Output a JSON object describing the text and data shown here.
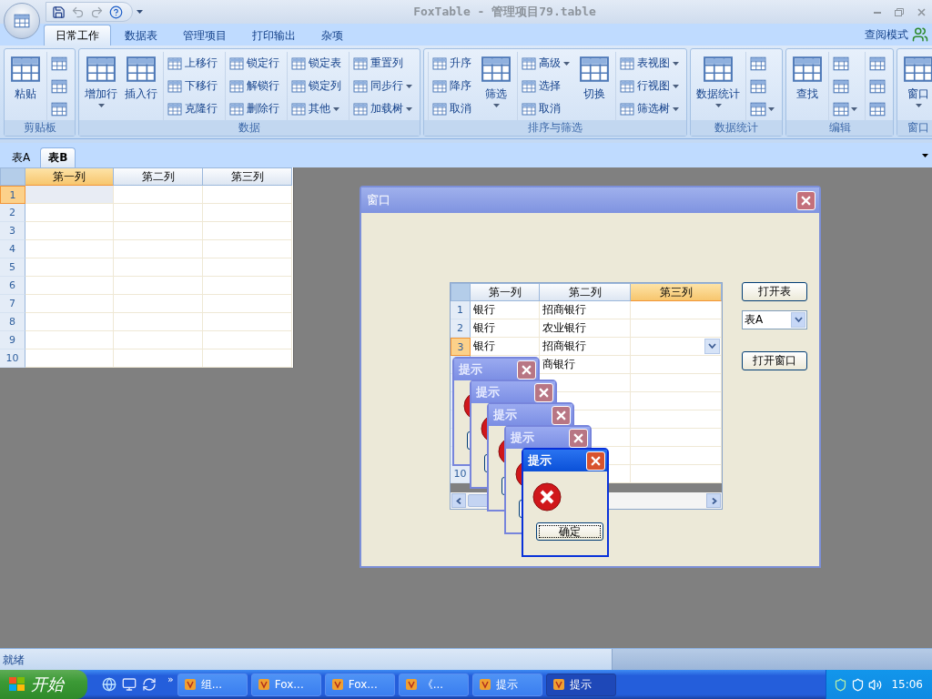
{
  "window": {
    "title": "FoxTable - 管理项目79.table"
  },
  "ribbon": {
    "tabs": [
      {
        "label": "日常工作",
        "selected": true
      },
      {
        "label": "数据表",
        "selected": false
      },
      {
        "label": "管理项目",
        "selected": false
      },
      {
        "label": "打印输出",
        "selected": false
      },
      {
        "label": "杂项",
        "selected": false
      }
    ],
    "mode_label": "查阅模式",
    "groups": [
      {
        "label": "剪贴板",
        "items": [
          {
            "kind": "large",
            "label": "粘贴",
            "dropdown": false
          },
          {
            "kind": "icons",
            "buttons": [
              {
                "dropdown": false
              },
              {
                "dropdown": false
              },
              {
                "dropdown": false
              }
            ]
          }
        ]
      },
      {
        "label": "数据",
        "items": [
          {
            "kind": "large",
            "label": "增加行",
            "dropdown": true
          },
          {
            "kind": "large",
            "label": "插入行",
            "dropdown": false
          },
          {
            "kind": "column",
            "buttons": [
              {
                "label": "上移行",
                "dropdown": false
              },
              {
                "label": "下移行",
                "dropdown": false
              },
              {
                "label": "克隆行",
                "dropdown": false
              }
            ]
          },
          {
            "kind": "column",
            "buttons": [
              {
                "label": "锁定行",
                "dropdown": false
              },
              {
                "label": "解锁行",
                "dropdown": false
              },
              {
                "label": "删除行",
                "dropdown": false
              }
            ]
          },
          {
            "kind": "column",
            "buttons": [
              {
                "label": "锁定表",
                "dropdown": false
              },
              {
                "label": "锁定列",
                "dropdown": false
              },
              {
                "label": "其他",
                "dropdown": true
              }
            ]
          },
          {
            "kind": "column",
            "buttons": [
              {
                "label": "重置列",
                "dropdown": false
              },
              {
                "label": "同步行",
                "dropdown": true
              },
              {
                "label": "加载树",
                "dropdown": true
              }
            ]
          }
        ]
      },
      {
        "label": "排序与筛选",
        "items": [
          {
            "kind": "column",
            "buttons": [
              {
                "label": "升序",
                "dropdown": false
              },
              {
                "label": "降序",
                "dropdown": false
              },
              {
                "label": "取消",
                "dropdown": false
              }
            ]
          },
          {
            "kind": "large",
            "label": "筛选",
            "dropdown": true
          },
          {
            "kind": "column",
            "buttons": [
              {
                "label": "高级",
                "dropdown": true
              },
              {
                "label": "选择",
                "dropdown": false
              },
              {
                "label": "取消",
                "dropdown": false
              }
            ]
          },
          {
            "kind": "large",
            "label": "切换",
            "dropdown": false
          },
          {
            "kind": "column",
            "buttons": [
              {
                "label": "表视图",
                "dropdown": true
              },
              {
                "label": "行视图",
                "dropdown": true
              },
              {
                "label": "筛选树",
                "dropdown": true
              }
            ]
          }
        ]
      },
      {
        "label": "数据统计",
        "items": [
          {
            "kind": "large",
            "label": "数据统计",
            "dropdown": true
          },
          {
            "kind": "icons",
            "buttons": [
              {
                "dropdown": false
              },
              {
                "dropdown": false
              },
              {
                "dropdown": true
              }
            ]
          }
        ]
      },
      {
        "label": "编辑",
        "items": [
          {
            "kind": "large",
            "label": "查找",
            "dropdown": false
          },
          {
            "kind": "icons",
            "buttons": [
              {
                "dropdown": false
              },
              {
                "dropdown": false
              },
              {
                "dropdown": true
              }
            ]
          },
          {
            "kind": "icons",
            "buttons": [
              {
                "dropdown": false
              },
              {
                "dropdown": false
              },
              {
                "dropdown": false
              }
            ]
          }
        ]
      },
      {
        "label": "窗口",
        "items": [
          {
            "kind": "large",
            "label": "窗口",
            "dropdown": true
          }
        ]
      }
    ]
  },
  "sheet_tabs": [
    {
      "label": "表A",
      "selected": false
    },
    {
      "label": "表B",
      "selected": true
    }
  ],
  "main_grid": {
    "columns": [
      {
        "label": "第一列",
        "selected": true
      },
      {
        "label": "第二列",
        "selected": false
      },
      {
        "label": "第三列",
        "selected": false
      }
    ],
    "rows": [
      {
        "number": "1",
        "selected": true
      },
      {
        "number": "2",
        "selected": false
      },
      {
        "number": "3",
        "selected": false
      },
      {
        "number": "4",
        "selected": false
      },
      {
        "number": "5",
        "selected": false
      },
      {
        "number": "6",
        "selected": false
      },
      {
        "number": "7",
        "selected": false
      },
      {
        "number": "8",
        "selected": false
      },
      {
        "number": "9",
        "selected": false
      },
      {
        "number": "10",
        "selected": false
      }
    ]
  },
  "inner_window": {
    "title": "窗口",
    "grid": {
      "columns": [
        {
          "label": "第一列",
          "selected": false
        },
        {
          "label": "第二列",
          "selected": false
        },
        {
          "label": "第三列",
          "selected": true
        }
      ],
      "rows": [
        {
          "number": "1",
          "selected": false,
          "col1": "银行",
          "col2": "招商银行",
          "cell_dropdown": false
        },
        {
          "number": "2",
          "selected": false,
          "col1": "银行",
          "col2": "农业银行",
          "cell_dropdown": false
        },
        {
          "number": "3",
          "selected": true,
          "col1": "银行",
          "col2": "招商银行",
          "cell_dropdown": true
        },
        {
          "selected": false,
          "col2": "商银行",
          "cell_dropdown": false
        },
        {
          "selected": false,
          "cell_dropdown": false
        },
        {
          "selected": false,
          "cell_dropdown": false
        },
        {
          "selected": false,
          "cell_dropdown": false
        },
        {
          "selected": false,
          "cell_dropdown": false
        },
        {
          "selected": false,
          "cell_dropdown": false
        },
        {
          "number": "10",
          "selected": false,
          "cell_dropdown": false
        }
      ]
    },
    "controls": [
      {
        "kind": "button",
        "label": "打开表"
      },
      {
        "kind": "combo",
        "value": "表A"
      },
      {
        "kind": "button",
        "label": "打开窗口"
      }
    ],
    "dialogs": [
      {
        "title": "提示",
        "active": false
      },
      {
        "title": "提示",
        "active": false
      },
      {
        "title": "提示",
        "active": false
      },
      {
        "title": "提示",
        "active": false
      },
      {
        "title": "提示",
        "active": true,
        "button": "确定"
      }
    ]
  },
  "status_bar": {
    "text": "就绪"
  },
  "taskbar": {
    "start": "开始",
    "more": "»",
    "tasks": [
      {
        "label": "组...",
        "selected": false
      },
      {
        "label": "Fox...",
        "selected": false
      },
      {
        "label": "Fox...",
        "selected": false
      },
      {
        "label": "《...",
        "selected": false
      },
      {
        "label": "提示",
        "selected": false
      },
      {
        "label": "提示",
        "selected": true
      }
    ],
    "clock": "15:06"
  }
}
